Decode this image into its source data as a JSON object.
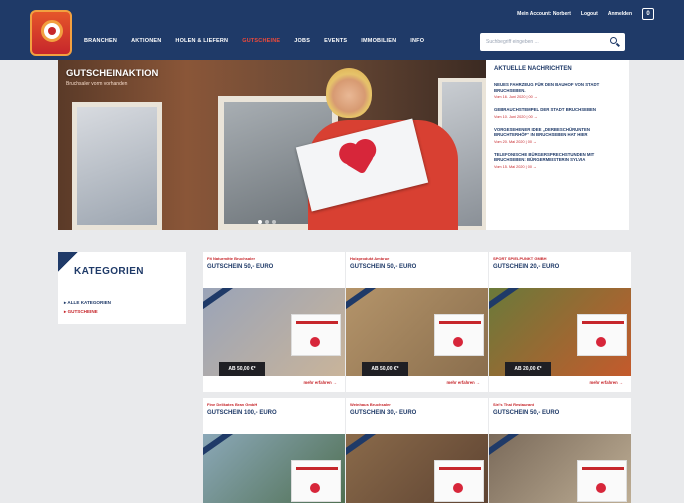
{
  "header": {
    "toplinks": [
      "Mein Account: Norbert",
      "Logout",
      "Anmelden"
    ],
    "cart_count": "0",
    "nav": [
      {
        "label": "BRANCHEN",
        "active": false
      },
      {
        "label": "AKTIONEN",
        "active": false
      },
      {
        "label": "HOLEN & LIEFERN",
        "active": false
      },
      {
        "label": "GUTSCHEINE",
        "active": true
      },
      {
        "label": "JOBS",
        "active": false
      },
      {
        "label": "EVENTS",
        "active": false
      },
      {
        "label": "IMMOBILIEN",
        "active": false
      },
      {
        "label": "INFO",
        "active": false
      }
    ],
    "search_placeholder": "Suchbegriff eingeben ..."
  },
  "hero": {
    "title": "GUTSCHEINAKTION",
    "subtitle": "Bruchsaler vorm vorhanden"
  },
  "news": {
    "heading": "AKTUELLE NACHRICHTEN",
    "items": [
      {
        "title": "NEUES FAHRZEUG FÜR DEN BAUHOF VON STADT BRUCHSEBEN.",
        "meta": "Vom 16. Juni 2020 | 00 →"
      },
      {
        "title": "GEBRAUCHSTEMPEL DER STADT BRUCHSEBEN",
        "meta": "Vom 10. Juni 2020 | 00 →"
      },
      {
        "title": "VORGESEHENER IDEE „DERBESCHÜRUNTEN BRUCHTERHÖF“ IN BRUCHSEBEN HAT HIER",
        "meta": "Vom 20. Mai 2020 | 00 →"
      },
      {
        "title": "TELEFONISCHE BÜRGERSPRECHSTUNDEN MIT BRUCHSEBEN: BÜRGERMEISTERIN SYLVIA",
        "meta": "Vom 15. Mai 2020 | 00 →"
      }
    ]
  },
  "categories": {
    "title": "KATEGORIEN",
    "items": [
      {
        "label": "ALLE KATEGORIEN",
        "red": false
      },
      {
        "label": "GUTSCHEINE",
        "red": true
      }
    ]
  },
  "products": [
    {
      "shop": "Fit Naturmitte Bruchsaler",
      "name": "GUTSCHEIN 50,- EURO",
      "price": "AB 50,00 €*",
      "more": "mehr erfahren →",
      "colors": [
        "#9aa4b8",
        "#c9b49a"
      ]
    },
    {
      "shop": "Holzprodukt Ambrue",
      "name": "GUTSCHEIN 50,- EURO",
      "price": "AB 50,00 €*",
      "more": "mehr erfahren →",
      "colors": [
        "#b4946a",
        "#8a6e4d"
      ]
    },
    {
      "shop": "SPORT SPIELPUNKT GMBH",
      "name": "GUTSCHEIN 20,- EURO",
      "price": "AB 20,00 €*",
      "more": "mehr erfahren →",
      "colors": [
        "#6a7a3a",
        "#c45a2c"
      ]
    },
    {
      "shop": "Fine Delikates Bran GmbH",
      "name": "GUTSCHEIN 100,- EURO",
      "price": "",
      "more": "",
      "colors": [
        "#8ba8b8",
        "#4a6a48"
      ]
    },
    {
      "shop": "Weinhaus Bruchsaler",
      "name": "GUTSCHEIN 30,- EURO",
      "price": "",
      "more": "",
      "colors": [
        "#8a6a4a",
        "#5a4030"
      ]
    },
    {
      "shop": "Siri's Thai Restaurant",
      "name": "GUTSCHEIN 50,- EURO",
      "price": "",
      "more": "",
      "colors": [
        "#7a6a5a",
        "#c4b49a"
      ]
    }
  ]
}
